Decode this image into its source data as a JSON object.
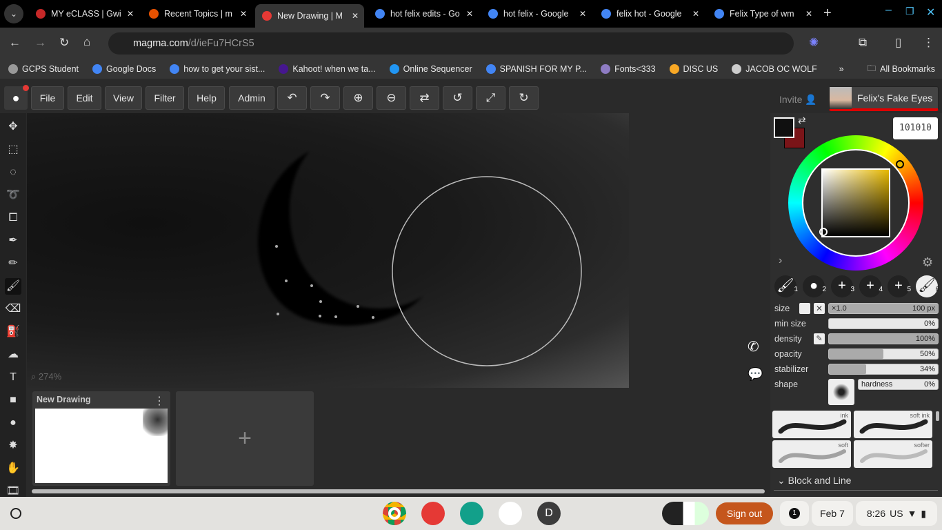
{
  "browser": {
    "tabs": [
      {
        "title": "MY eCLASS | Gwi",
        "color": "#c62828"
      },
      {
        "title": "Recent Topics | m",
        "color": "#e65100"
      },
      {
        "title": "New Drawing | M",
        "color": "#e53935",
        "active": true
      },
      {
        "title": "hot felix edits - Go",
        "color": "#4285f4"
      },
      {
        "title": "hot felix - Google",
        "color": "#4285f4"
      },
      {
        "title": "felix hot - Google",
        "color": "#4285f4"
      },
      {
        "title": "Felix Type of wm",
        "color": "#4285f4"
      }
    ],
    "url_host": "magma.com",
    "url_path": "/d/ieFu7HCrS5",
    "bookmarks": [
      {
        "label": "GCPS Student",
        "color": "#999"
      },
      {
        "label": "Google Docs",
        "color": "#4285f4"
      },
      {
        "label": "how to get your sist...",
        "color": "#4285f4"
      },
      {
        "label": "Kahoot! when we ta...",
        "color": "#46178f"
      },
      {
        "label": "Online Sequencer",
        "color": "#2196f3"
      },
      {
        "label": "SPANISH FOR MY P...",
        "color": "#4285f4"
      },
      {
        "label": "Fonts<333",
        "color": "#8e7cc3"
      },
      {
        "label": "DISC US",
        "color": "#f9a825"
      },
      {
        "label": "JACOB OC WOLF",
        "color": "#ccc"
      }
    ],
    "all_bookmarks": "All Bookmarks"
  },
  "menu": {
    "items": [
      "File",
      "Edit",
      "View",
      "Filter",
      "Help",
      "Admin"
    ],
    "invite": "Invite",
    "user": "Felix's Fake Eyes"
  },
  "canvas": {
    "zoom": "274%"
  },
  "documents": {
    "current": "New Drawing"
  },
  "color": {
    "hex": "101010",
    "primary": "#101010",
    "secondary": "#7a1418"
  },
  "brush": {
    "slots": [
      "1",
      "2",
      "3",
      "4",
      "5",
      "6"
    ],
    "size": {
      "label": "size",
      "mult": "×1.0",
      "value": "100 px",
      "fraction": 1.0
    },
    "min_size": {
      "label": "min size",
      "value": "0%",
      "fraction": 0
    },
    "density": {
      "label": "density",
      "value": "100%",
      "fraction": 1.0
    },
    "opacity": {
      "label": "opacity",
      "value": "50%",
      "fraction": 0.5
    },
    "stabilizer": {
      "label": "stabilizer",
      "value": "34%",
      "fraction": 0.34
    },
    "shape": {
      "label": "shape",
      "hardness_label": "hardness",
      "hardness": "0%"
    },
    "presets": [
      "ink",
      "soft ink",
      "soft",
      "softer"
    ],
    "section": "Block and Line"
  },
  "taskbar": {
    "sign_out": "Sign out",
    "notifications": "1",
    "date": "Feb 7",
    "time": "8:26",
    "locale": "US",
    "account_initial": "D"
  }
}
